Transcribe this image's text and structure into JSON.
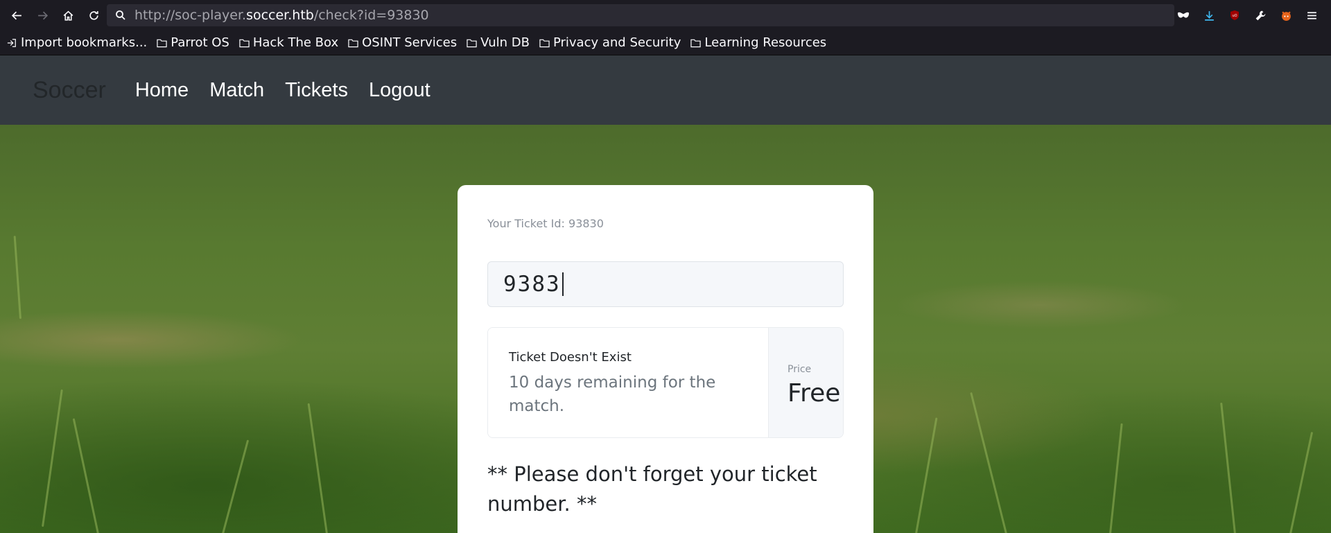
{
  "browser": {
    "url_prefix": "http://soc-player.",
    "url_host": "soccer.htb",
    "url_path": "/check?id=93830",
    "bookmarks": [
      "Import bookmarks...",
      "Parrot OS",
      "Hack The Box",
      "OSINT Services",
      "Vuln DB",
      "Privacy and Security",
      "Learning Resources"
    ]
  },
  "navbar": {
    "brand": "Soccer",
    "links": [
      "Home",
      "Match",
      "Tickets",
      "Logout"
    ]
  },
  "ticket": {
    "id_label": "Your Ticket Id: 93830",
    "input_value": "9383",
    "result_title": "Ticket Doesn't Exist",
    "result_desc": "10 days remaining for the match.",
    "price_label": "Price",
    "price_value": "Free",
    "reminder": "** Please don't forget your ticket number. **"
  }
}
